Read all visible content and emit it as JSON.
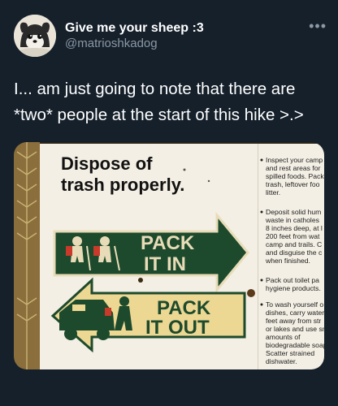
{
  "user": {
    "name": "Give me your sheep :3",
    "handle": "@matrioshkadog",
    "more_icon": "ellipsis-icon"
  },
  "tweet": {
    "text": "I... am just going to note that there are *two* people at the start of this hike >.>"
  },
  "sign": {
    "heading_line1": "Dispose of",
    "heading_line2": "trash properly.",
    "pack_in_line1": "PACK",
    "pack_in_line2": "IT IN",
    "pack_out_line1": "PACK",
    "pack_out_line2": "IT OUT",
    "tips": [
      "Inspect your camp",
      "and rest areas for",
      "spilled foods. Pack",
      "trash, leftover foo",
      "litter.",
      "Deposit solid hum",
      "waste in catholes",
      "8 inches deep, at l",
      "200 feet from wat",
      "camp and trails. C",
      "and disguise the c",
      "when finished.",
      "Pack out toilet pa",
      "hygiene products.",
      "To wash yourself o",
      "dishes, carry water",
      "feet away from str",
      "or lakes and use sm",
      "amounts of",
      "biodegradable soap",
      "Scatter strained",
      "dishwater."
    ],
    "colors": {
      "green": "#1d4a2c",
      "cream": "#e8dcb8",
      "yellow": "#ecd793",
      "paper": "#f3efe4"
    }
  }
}
